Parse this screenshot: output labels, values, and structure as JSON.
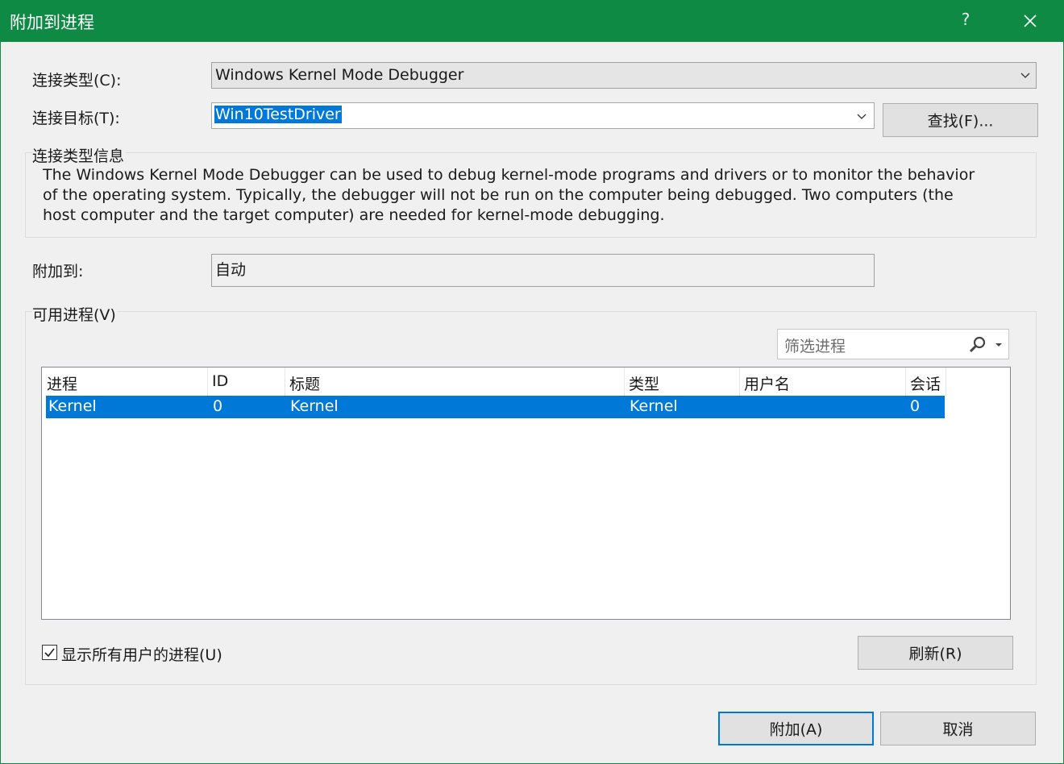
{
  "window": {
    "title": "附加到进程",
    "help": "?"
  },
  "connection_type": {
    "label": "连接类型(C):",
    "value": "Windows Kernel Mode Debugger"
  },
  "connection_target": {
    "label": "连接目标(T):",
    "value": "Win10TestDriver",
    "find_button": "查找(F)..."
  },
  "connection_info": {
    "group_label": "连接类型信息",
    "text": "The Windows Kernel Mode Debugger can be used to debug kernel-mode programs and drivers or to monitor the behavior of the operating system. Typically, the debugger will not be run on the computer being debugged. Two computers (the host computer and the target computer) are needed for kernel-mode debugging."
  },
  "attach_to": {
    "label": "附加到:",
    "value": "自动"
  },
  "processes": {
    "group_label": "可用进程(V)",
    "filter_placeholder": "筛选进程",
    "columns": [
      "进程",
      "ID",
      "标题",
      "类型",
      "用户名",
      "会话"
    ],
    "rows": [
      {
        "process": "Kernel",
        "id": "0",
        "title": "Kernel",
        "type": "Kernel",
        "user": "",
        "session": "0",
        "selected": true
      }
    ],
    "show_all_users": {
      "label": "显示所有用户的进程(U)",
      "checked": true
    },
    "refresh_button": "刷新(R)"
  },
  "footer": {
    "attach_button": "附加(A)",
    "cancel_button": "取消"
  }
}
